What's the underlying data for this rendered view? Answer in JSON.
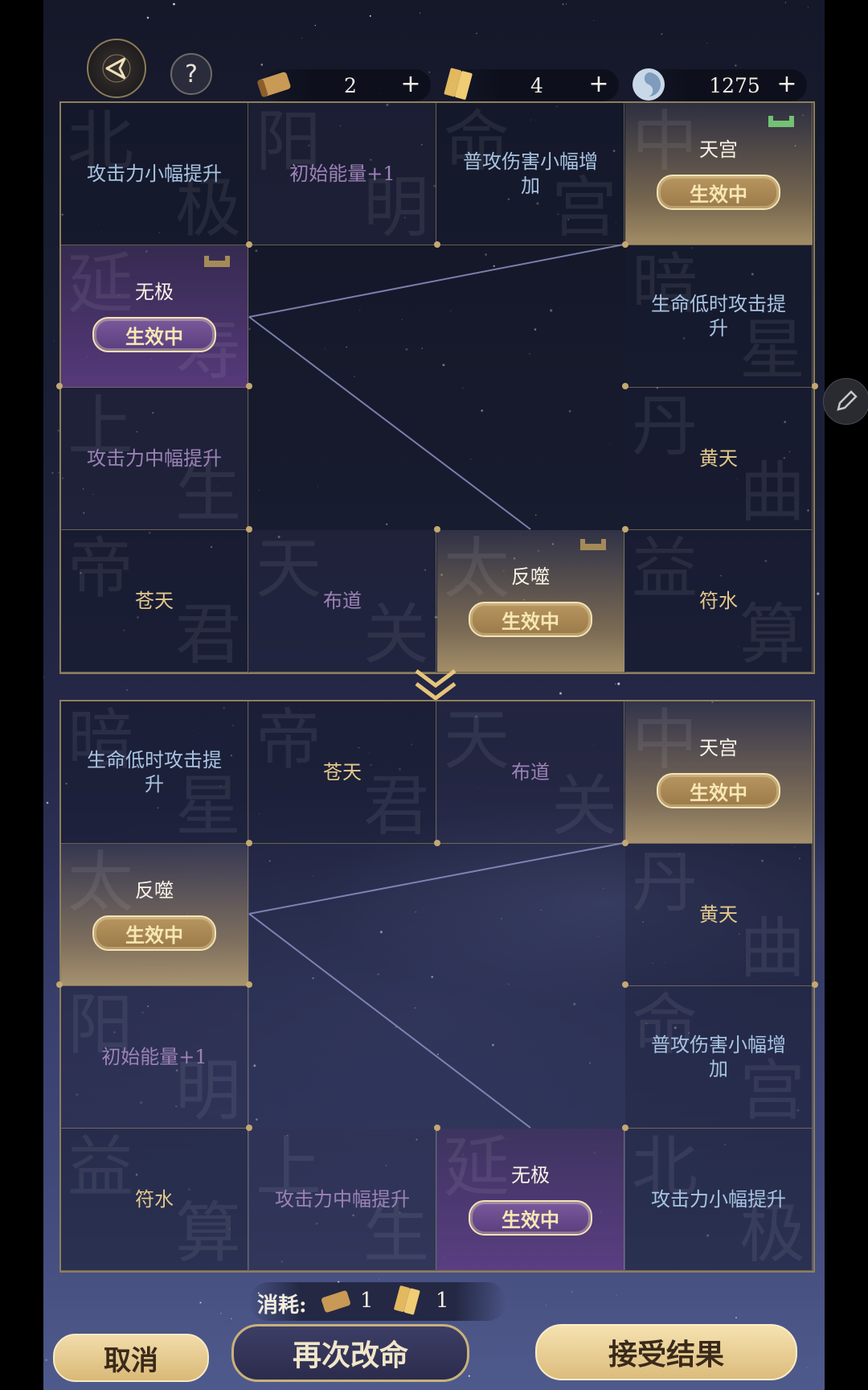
{
  "resources": [
    {
      "name": "scroll-icon",
      "value": "2"
    },
    {
      "name": "tablet-icon",
      "value": "4"
    },
    {
      "name": "jade-orb-icon",
      "value": "1275"
    }
  ],
  "plus_label": "+",
  "help_label": "?",
  "active_label": "生效中",
  "top_grid": {
    "cells": [
      {
        "label": "攻击力小幅提升",
        "bg": "北",
        "bg2": "极",
        "style": "blue"
      },
      {
        "label": "初始能量+1",
        "bg": "阳",
        "bg2": "明",
        "style": "purple"
      },
      {
        "label": "普攻伤害小幅增加",
        "bg": "命",
        "bg2": "宫",
        "style": "blue"
      },
      {
        "label": "天宫",
        "bg": "中",
        "bg2": "",
        "style": "gold-active"
      },
      {
        "label": "无极",
        "bg": "延",
        "bg2": "寿",
        "style": "purple-active"
      },
      {
        "label": "生命低时攻击提升",
        "bg": "暗",
        "bg2": "星",
        "style": "blue"
      },
      {
        "label": "攻击力中幅提升",
        "bg": "上",
        "bg2": "生",
        "style": "purple"
      },
      {
        "label": "黄天",
        "bg": "丹",
        "bg2": "曲",
        "style": "gold"
      },
      {
        "label": "苍天",
        "bg": "帝",
        "bg2": "君",
        "style": "gold"
      },
      {
        "label": "布道",
        "bg": "天",
        "bg2": "关",
        "style": "purple"
      },
      {
        "label": "反噬",
        "bg": "太",
        "bg2": "",
        "style": "gold-active"
      },
      {
        "label": "符水",
        "bg": "益",
        "bg2": "算",
        "style": "gold"
      }
    ]
  },
  "bottom_grid": {
    "cells": [
      {
        "label": "生命低时攻击提升",
        "bg": "暗",
        "bg2": "星",
        "style": "blue"
      },
      {
        "label": "苍天",
        "bg": "帝",
        "bg2": "君",
        "style": "gold"
      },
      {
        "label": "布道",
        "bg": "天",
        "bg2": "关",
        "style": "purple"
      },
      {
        "label": "天宫",
        "bg": "中",
        "bg2": "",
        "style": "gold-active"
      },
      {
        "label": "反噬",
        "bg": "太",
        "bg2": "",
        "style": "gold-active"
      },
      {
        "label": "黄天",
        "bg": "丹",
        "bg2": "曲",
        "style": "gold"
      },
      {
        "label": "初始能量+1",
        "bg": "阳",
        "bg2": "明",
        "style": "purple"
      },
      {
        "label": "普攻伤害小幅增加",
        "bg": "命",
        "bg2": "宫",
        "style": "blue"
      },
      {
        "label": "符水",
        "bg": "益",
        "bg2": "算",
        "style": "gold"
      },
      {
        "label": "攻击力中幅提升",
        "bg": "上",
        "bg2": "生",
        "style": "purple"
      },
      {
        "label": "无极",
        "bg": "延",
        "bg2": "",
        "style": "purple-active"
      },
      {
        "label": "攻击力小幅提升",
        "bg": "北",
        "bg2": "极",
        "style": "blue"
      }
    ]
  },
  "cost": {
    "label": "消耗:",
    "scroll": "1",
    "tablet": "1"
  },
  "buttons": {
    "cancel": "取消",
    "retry": "再次改命",
    "accept": "接受结果"
  },
  "colors": {
    "gold": "#e4c98c",
    "blue": "#a8c4e2",
    "purple": "#9c82b6",
    "accent_border": "#8f7f5a"
  }
}
